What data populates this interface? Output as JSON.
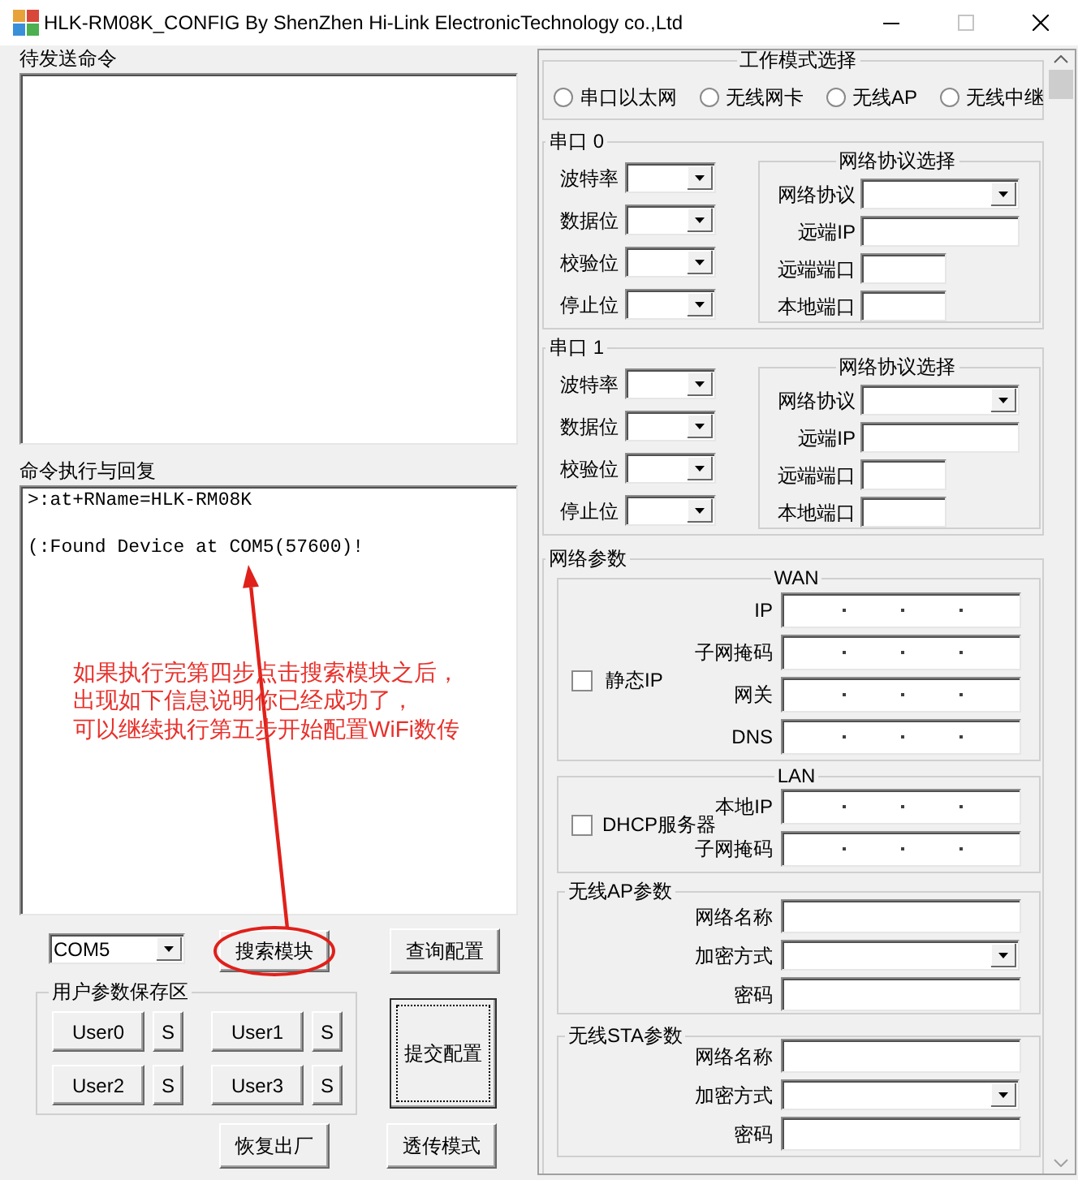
{
  "window": {
    "title": "HLK-RM08K_CONFIG By ShenZhen Hi-Link ElectronicTechnology co.,Ltd"
  },
  "send_panel": {
    "label": "待发送命令"
  },
  "reply_panel": {
    "label": "命令执行与回复",
    "lines": [
      ">:at+RName=HLK-RM08K",
      "(:Found Device at COM5(57600)!"
    ]
  },
  "annotation": {
    "lines": [
      "如果执行完第四步点击搜索模块之后，",
      "出现如下信息说明你已经成功了，",
      "可以继续执行第五步开始配置WiFi数传"
    ]
  },
  "port_select": {
    "value": "COM5"
  },
  "search_button": {
    "label": "搜索模块",
    "circled": true
  },
  "query_button": {
    "label": "查询配置"
  },
  "user_group": {
    "title": "用户参数保存区",
    "slots": [
      {
        "label": "User0",
        "save": "S"
      },
      {
        "label": "User1",
        "save": "S"
      },
      {
        "label": "User2",
        "save": "S"
      },
      {
        "label": "User3",
        "save": "S"
      }
    ]
  },
  "submit_button": {
    "label": "提交配置",
    "focused": true
  },
  "restore_button": {
    "label": "恢复出厂"
  },
  "passthrough_button": {
    "label": "透传模式"
  },
  "work_mode": {
    "title": "工作模式选择",
    "options": [
      {
        "label": "串口以太网",
        "selected": false
      },
      {
        "label": "无线网卡",
        "selected": false
      },
      {
        "label": "无线AP",
        "selected": false
      },
      {
        "label": "无线中继",
        "selected": false
      }
    ]
  },
  "serial_ports": [
    {
      "title": "串口 0",
      "fields": [
        {
          "label": "波特率"
        },
        {
          "label": "数据位"
        },
        {
          "label": "校验位"
        },
        {
          "label": "停止位"
        }
      ],
      "protocol": {
        "title": "网络协议选择",
        "fields": [
          {
            "label": "网络协议",
            "kind": "select"
          },
          {
            "label": "远端IP",
            "kind": "input"
          },
          {
            "label": "远端端口",
            "kind": "short_input"
          },
          {
            "label": "本地端口",
            "kind": "short_input"
          }
        ]
      }
    },
    {
      "title": "串口 1",
      "fields": [
        {
          "label": "波特率"
        },
        {
          "label": "数据位"
        },
        {
          "label": "校验位"
        },
        {
          "label": "停止位"
        }
      ],
      "protocol": {
        "title": "网络协议选择",
        "fields": [
          {
            "label": "网络协议",
            "kind": "select"
          },
          {
            "label": "远端IP",
            "kind": "input"
          },
          {
            "label": "远端端口",
            "kind": "short_input"
          },
          {
            "label": "本地端口",
            "kind": "short_input"
          }
        ]
      }
    }
  ],
  "network": {
    "title": "网络参数",
    "wan": {
      "title": "WAN",
      "checkbox": {
        "label": "静态IP",
        "checked": false
      },
      "fields": [
        {
          "label": "IP"
        },
        {
          "label": "子网掩码"
        },
        {
          "label": "网关"
        },
        {
          "label": "DNS"
        }
      ]
    },
    "lan": {
      "title": "LAN",
      "checkbox": {
        "label": "DHCP服务器",
        "checked": false
      },
      "fields": [
        {
          "label": "本地IP"
        },
        {
          "label": "子网掩码"
        }
      ]
    },
    "wireless": [
      {
        "title": "无线AP参数",
        "fields": [
          {
            "label": "网络名称",
            "kind": "input"
          },
          {
            "label": "加密方式",
            "kind": "select"
          },
          {
            "label": "密码",
            "kind": "input"
          }
        ]
      },
      {
        "title": "无线STA参数",
        "fields": [
          {
            "label": "网络名称",
            "kind": "input"
          },
          {
            "label": "加密方式",
            "kind": "select"
          },
          {
            "label": "密码",
            "kind": "input"
          }
        ]
      }
    ]
  }
}
